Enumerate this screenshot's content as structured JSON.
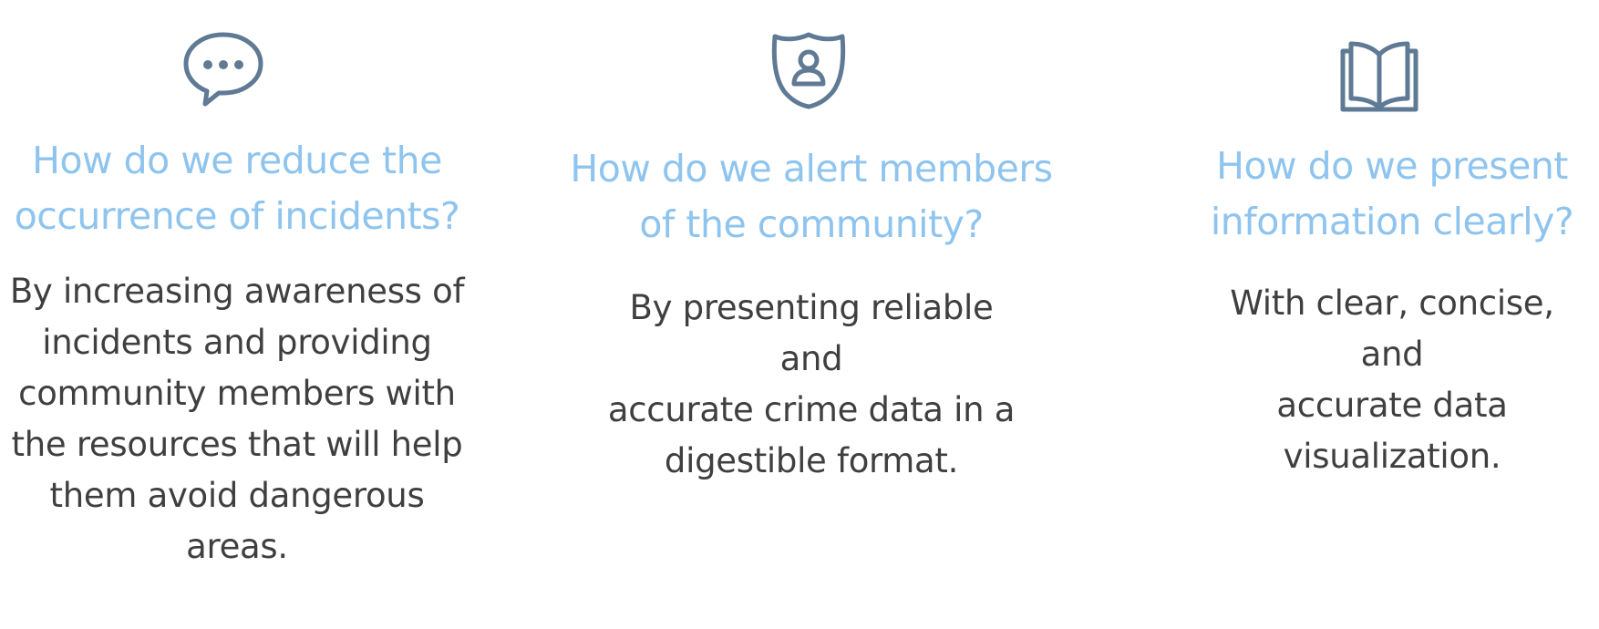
{
  "colors": {
    "heading": "#8ec4ee",
    "body": "#3f3f3f",
    "icon": "#5f7a94"
  },
  "features": [
    {
      "icon": "chat-bubble-icon",
      "heading_lines": [
        "How do we reduce the",
        "occurrence of incidents?"
      ],
      "body_lines": [
        "By increasing awareness of",
        "incidents and providing",
        "community members with",
        "the resources that will help",
        "them avoid dangerous",
        "areas."
      ]
    },
    {
      "icon": "shield-user-icon",
      "heading_lines": [
        "How do we alert members",
        "of the community?"
      ],
      "body_lines": [
        "By presenting reliable and",
        "accurate crime data in a",
        "digestible format."
      ]
    },
    {
      "icon": "open-book-icon",
      "heading_lines": [
        "How do we present",
        "information clearly?"
      ],
      "body_lines": [
        "With clear, concise, and",
        "accurate data",
        "visualization."
      ]
    }
  ]
}
